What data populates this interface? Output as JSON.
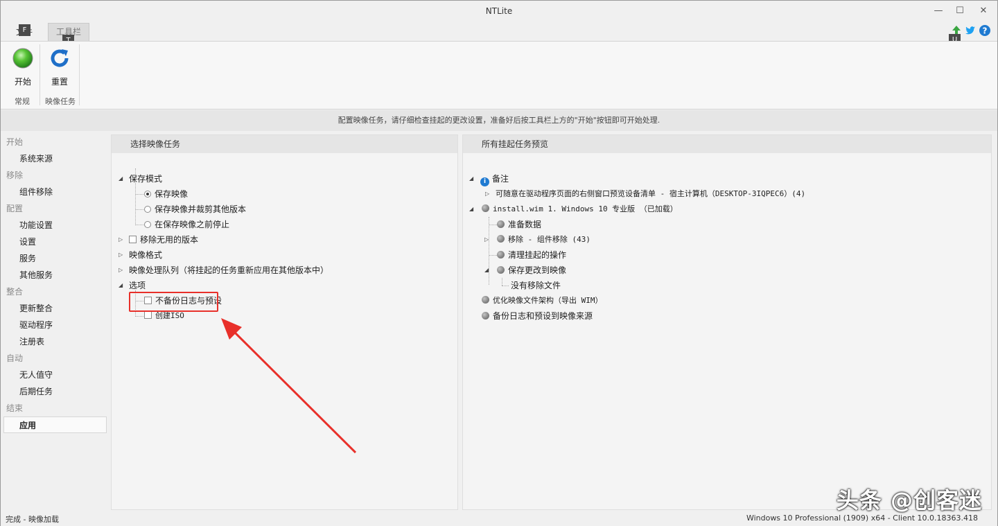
{
  "window": {
    "title": "NTLite"
  },
  "controls": {
    "minimize": "—",
    "maximize": "☐",
    "close": "✕"
  },
  "tabs": {
    "file": "文件",
    "toolbar": "工具栏"
  },
  "keytips": {
    "file": "F",
    "toolbar": "T",
    "top": "U"
  },
  "ribbon": {
    "start_label": "开始",
    "reset_label": "重置",
    "group_general": "常规",
    "group_image_tasks": "映像任务"
  },
  "infobar": {
    "text": "配置映像任务，请仔细检查挂起的更改设置，准备好后按工具栏上方的\"开始\"按钮即可开始处理."
  },
  "sidebar": {
    "sections": [
      {
        "head": "开始",
        "items": [
          "系统来源"
        ]
      },
      {
        "head": "移除",
        "items": [
          "组件移除"
        ]
      },
      {
        "head": "配置",
        "items": [
          "功能设置",
          "设置",
          "服务",
          "其他服务"
        ]
      },
      {
        "head": "整合",
        "items": [
          "更新整合",
          "驱动程序",
          "注册表"
        ]
      },
      {
        "head": "自动",
        "items": [
          "无人值守",
          "后期任务"
        ]
      },
      {
        "head": "结束",
        "items": [
          "应用"
        ]
      }
    ]
  },
  "left_panel": {
    "header": "选择映像任务",
    "save_mode": "保存模式",
    "save_image": "保存映像",
    "save_trim": "保存映像并裁剪其他版本",
    "stop_before": "在保存映像之前停止",
    "remove_unused": "移除无用的版本",
    "image_format": "映像格式",
    "queue": "映像处理队列（将挂起的任务重新应用在其他版本中）",
    "options": "选项",
    "no_backup": "不备份日志与预设",
    "create_iso": "创建ISO"
  },
  "right_panel": {
    "header": "所有挂起任务预览",
    "notes": "备注",
    "note_line": "可随意在驱动程序页面的右侧窗口预览设备清单 - 宿主计算机（DESKTOP-3IQPEC6）(4)",
    "install_wim": "install.wim 1. Windows 10 专业版 （已加载）",
    "prepare": "准备数据",
    "remove": "移除 - 组件移除 (43)",
    "cleanup": "清理挂起的操作",
    "save_changes": "保存更改到映像",
    "no_remove": "没有移除文件",
    "optimize": "优化映像文件架构（导出 WIM）",
    "backup": "备份日志和预设到映像来源"
  },
  "status": {
    "left": "完成 - 映像加载",
    "right": "Windows 10 Professional (1909) x64 - Client 10.0.18363.418"
  },
  "watermark": "头条 @创客迷",
  "colors": {
    "highlight_box": "#e8302a",
    "info_icon": "#1f7ad1"
  }
}
